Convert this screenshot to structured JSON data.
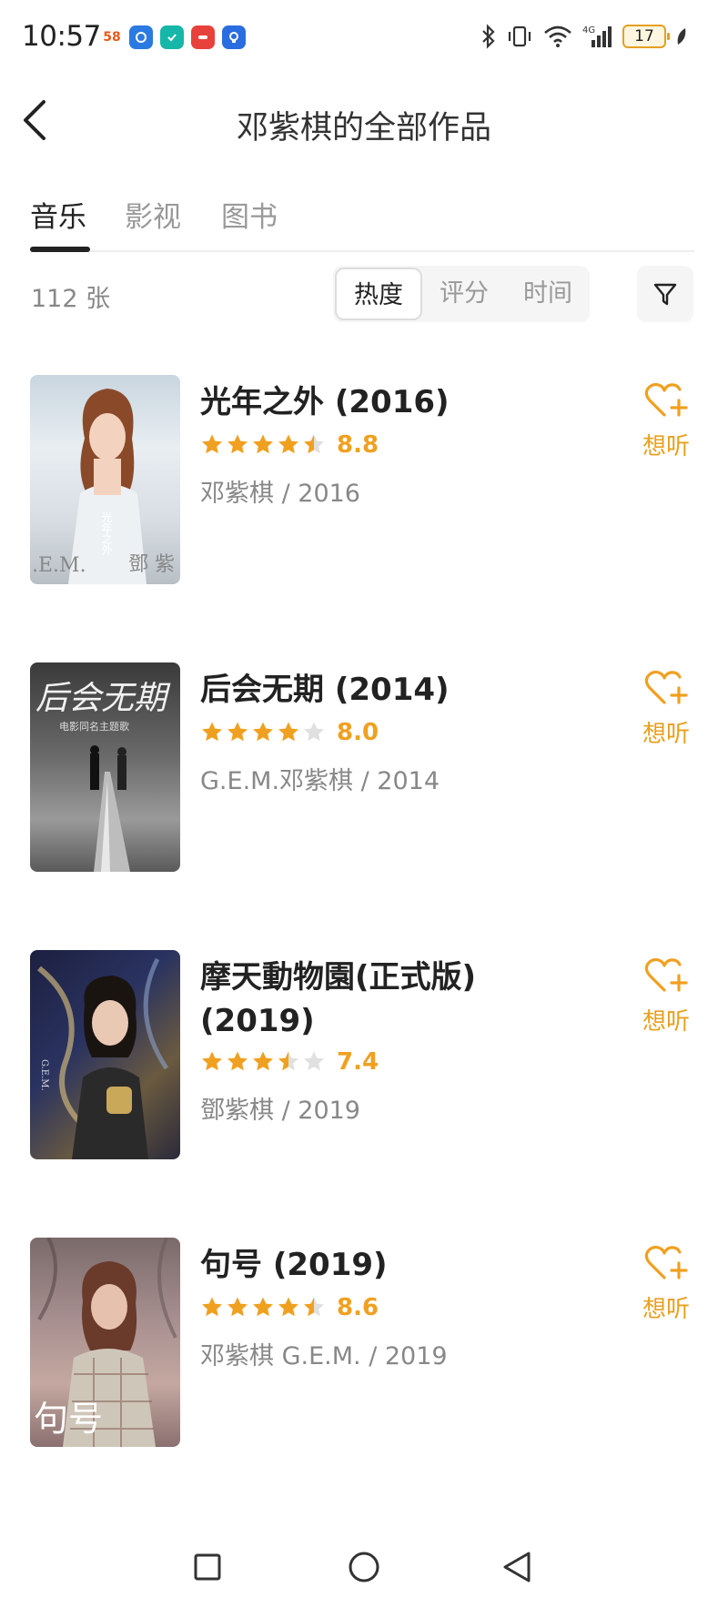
{
  "status_bar": {
    "time": "10:57",
    "app_badge": "58",
    "battery": "17"
  },
  "header": {
    "title": "邓紫棋的全部作品"
  },
  "tabs": [
    {
      "label": "音乐",
      "active": true
    },
    {
      "label": "影视",
      "active": false
    },
    {
      "label": "图书",
      "active": false
    }
  ],
  "filter": {
    "count": "112 张",
    "sort_options": [
      "热度",
      "评分",
      "时间"
    ],
    "active_sort": "热度"
  },
  "items": [
    {
      "title": "光年之外 (2016)",
      "rating": 8.8,
      "stars": 4.5,
      "meta": "邓紫棋 / 2016",
      "want_label": "想听",
      "cover_texts": [
        ".E.M.",
        "鄧 紫",
        "光年之外"
      ]
    },
    {
      "title": "后会无期 (2014)",
      "rating": 8.0,
      "stars": 4,
      "meta": "G.E.M.邓紫棋 / 2014",
      "want_label": "想听",
      "cover_texts": [
        "后会无期",
        "电影同名主题歌"
      ]
    },
    {
      "title": "摩天動物園(正式版) (2019)",
      "rating": 7.4,
      "stars": 3.5,
      "meta": "鄧紫棋 / 2019",
      "want_label": "想听",
      "cover_texts": [
        "G.E.M."
      ]
    },
    {
      "title": "句号 (2019)",
      "rating": 8.6,
      "stars": 4.5,
      "meta": "邓紫棋 G.E.M. / 2019",
      "want_label": "想听",
      "cover_texts": [
        "句号"
      ]
    }
  ],
  "colors": {
    "accent": "#f0a020",
    "star_empty": "#e0e0e0",
    "text_primary": "#222222",
    "text_secondary": "#888888"
  }
}
